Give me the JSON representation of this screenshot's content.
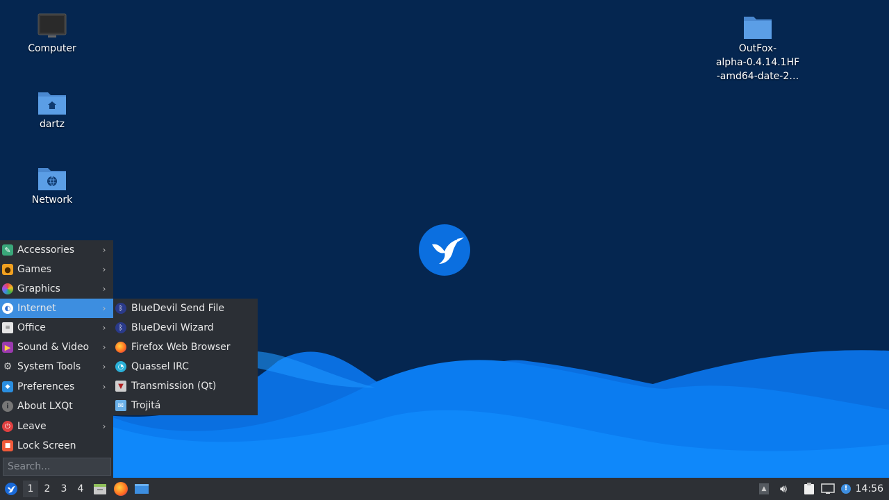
{
  "desktop": {
    "icons": [
      {
        "label": "Computer",
        "icon": "computer-icon"
      },
      {
        "label": "dartz",
        "icon": "home-folder-icon"
      },
      {
        "label": "Network",
        "icon": "network-folder-icon"
      }
    ],
    "file_icon": {
      "line1": "OutFox-",
      "line2": "alpha-0.4.14.1HF",
      "line3": "-amd64-date-2…",
      "icon": "folder-icon"
    }
  },
  "menu": {
    "items": [
      {
        "label": "Accessories",
        "icon": "accessories-icon",
        "submenu": true
      },
      {
        "label": "Games",
        "icon": "games-icon",
        "submenu": true
      },
      {
        "label": "Graphics",
        "icon": "graphics-icon",
        "submenu": true
      },
      {
        "label": "Internet",
        "icon": "internet-icon",
        "submenu": true,
        "active": true
      },
      {
        "label": "Office",
        "icon": "office-icon",
        "submenu": true
      },
      {
        "label": "Sound & Video",
        "icon": "sound-video-icon",
        "submenu": true
      },
      {
        "label": "System Tools",
        "icon": "system-tools-icon",
        "submenu": true
      },
      {
        "label": "Preferences",
        "icon": "preferences-icon",
        "submenu": true
      },
      {
        "label": "About LXQt",
        "icon": "info-icon",
        "submenu": false
      },
      {
        "label": "Leave",
        "icon": "power-icon",
        "submenu": true
      },
      {
        "label": "Lock Screen",
        "icon": "lock-icon",
        "submenu": false
      }
    ],
    "search_placeholder": "Search..."
  },
  "internet_submenu": {
    "items": [
      {
        "label": "BlueDevil Send File",
        "icon": "bluetooth-icon"
      },
      {
        "label": "BlueDevil Wizard",
        "icon": "bluetooth-icon"
      },
      {
        "label": "Firefox Web Browser",
        "icon": "firefox-icon"
      },
      {
        "label": "Quassel IRC",
        "icon": "quassel-icon"
      },
      {
        "label": "Transmission (Qt)",
        "icon": "transmission-icon"
      },
      {
        "label": "Trojitá",
        "icon": "mail-icon"
      }
    ]
  },
  "taskbar": {
    "workspaces": [
      "1",
      "2",
      "3",
      "4"
    ],
    "active_workspace": "1",
    "clock": "14:56"
  },
  "colors": {
    "desktop_bg": "#052650",
    "accent": "#3d8ee0",
    "menu_bg": "#2b2f35",
    "taskbar_bg": "#2d3035"
  }
}
